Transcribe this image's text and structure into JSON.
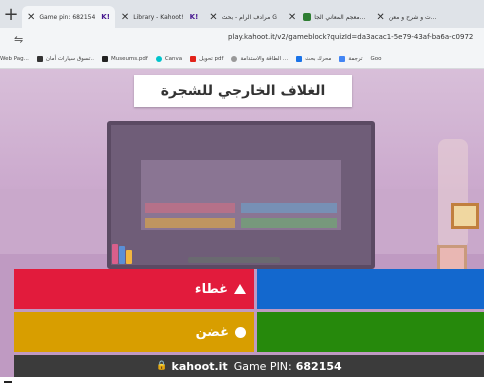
{
  "browser": {
    "tabs": [
      {
        "title": "Game pin: 682154",
        "badge": "K!",
        "active": true
      },
      {
        "title": "Library - Kahoot!",
        "badge": "K!",
        "active": false
      },
      {
        "title": "مرادف الرام - بحث G",
        "badge": "",
        "active": false
      },
      {
        "title": "معجم المعاني الجا...",
        "badge": "",
        "active": false
      },
      {
        "title": "ت و شرح و معن...",
        "badge": "",
        "active": false
      }
    ],
    "url": "play.kahoot.it/v2/gameblock?quizId=da3acac1-5e79-43af-ba6a-c0972",
    "bookmarks": [
      {
        "label": "Web Pag...",
        "color": "#333333"
      },
      {
        "label": "تسوق سيارات أمان..",
        "color": "#111111"
      },
      {
        "label": "Museums.pdf",
        "color": "#222222"
      },
      {
        "label": "Canva",
        "color": "#00c4cc"
      },
      {
        "label": "تحويل pdf",
        "color": "#e2231a"
      },
      {
        "label": "الطاقة والاستدامة ...",
        "color": "#999999"
      },
      {
        "label": "محرك بحث",
        "color": "#1a73e8"
      },
      {
        "label": "ترجمة",
        "color": "#4285f4"
      },
      {
        "label": "Goo",
        "color": "#34a853"
      }
    ]
  },
  "game": {
    "question": "الغلاف الخارجي للشجرة",
    "answers": [
      {
        "text": "غطاء",
        "shape": "triangle-icon",
        "color": "#e21b3c"
      },
      {
        "text": "",
        "shape": "diamond-icon",
        "color": "#1368ce"
      },
      {
        "text": "غضن",
        "shape": "circle-icon",
        "color": "#d89e00"
      },
      {
        "text": "",
        "shape": "square-icon",
        "color": "#26890c"
      }
    ],
    "footer": {
      "brand": "kahoot.it",
      "pin_label": "Game PIN:",
      "pin": "682154"
    }
  }
}
